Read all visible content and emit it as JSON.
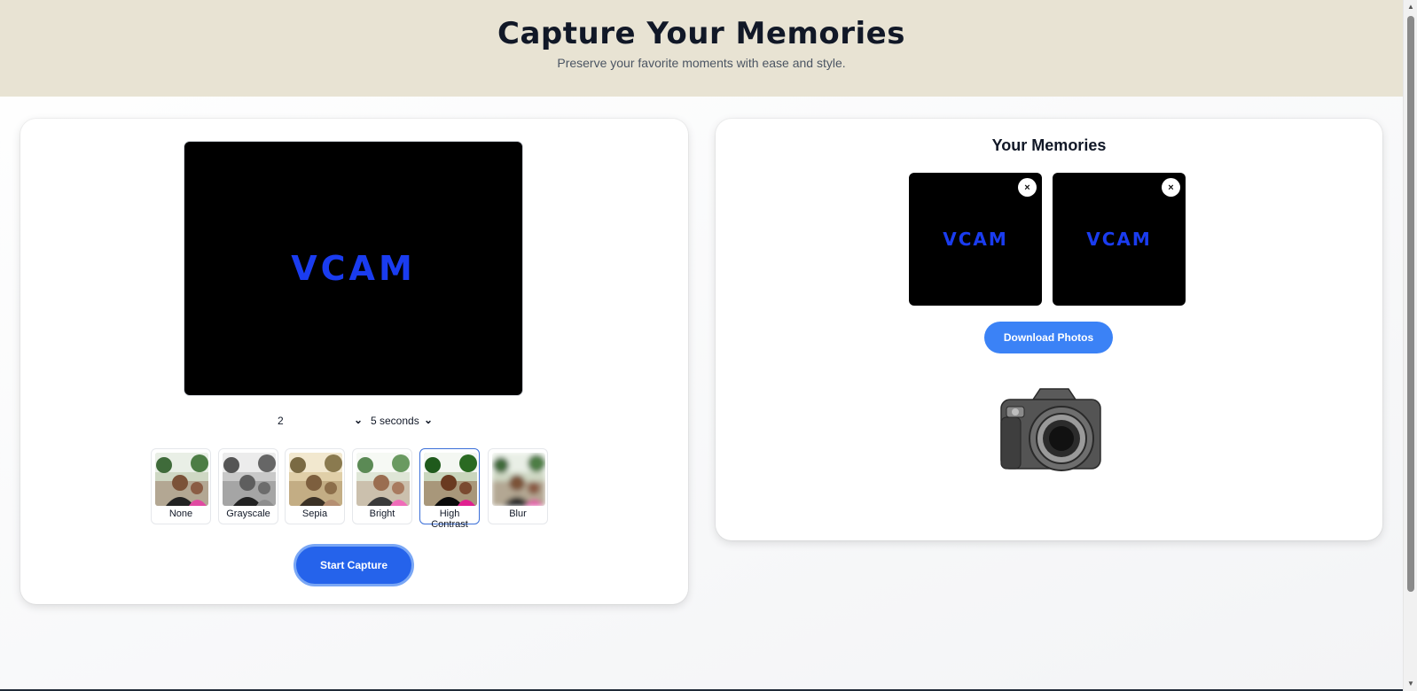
{
  "header": {
    "title": "Capture Your Memories",
    "subtitle": "Preserve your favorite moments with ease and style."
  },
  "camera_panel": {
    "preview_watermark": "VCAM",
    "photo_count_select": {
      "selected": "2"
    },
    "timer_select": {
      "selected": "5 seconds"
    },
    "filters": [
      {
        "label": "None",
        "selected": false
      },
      {
        "label": "Grayscale",
        "selected": false
      },
      {
        "label": "Sepia",
        "selected": false
      },
      {
        "label": "Bright",
        "selected": false
      },
      {
        "label": "High Contrast",
        "selected": true
      },
      {
        "label": "Blur",
        "selected": false
      }
    ],
    "start_button": "Start Capture"
  },
  "memories_panel": {
    "title": "Your Memories",
    "photos": [
      {
        "watermark": "VCAM",
        "remove_symbol": "×"
      },
      {
        "watermark": "VCAM",
        "remove_symbol": "×"
      }
    ],
    "download_button": "Download Photos"
  },
  "colors": {
    "header_bg": "#e8e3d3",
    "primary_button": "#2563eb",
    "download_button": "#3b82f6",
    "watermark": "#1a3cf0"
  },
  "icons": {
    "select_chevron": "chevron-down-icon",
    "remove": "close-icon",
    "illustration": "camera-icon"
  }
}
